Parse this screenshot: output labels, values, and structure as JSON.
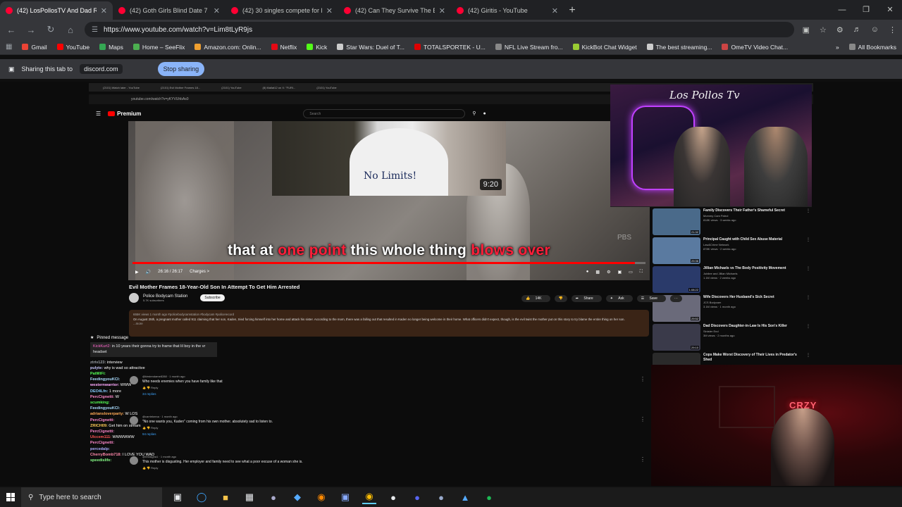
{
  "browser": {
    "tabs": [
      {
        "title": "(42) LosPollosTV And Dad R...",
        "active": true
      },
      {
        "title": "(42) Goth Girls Blind Date 7 Ni...",
        "active": false
      },
      {
        "title": "(42) 30 singles compete for lov...",
        "active": false
      },
      {
        "title": "(42) Can They Survive The Brea...",
        "active": false
      },
      {
        "title": "(42) Giritis - YouTube",
        "active": false
      }
    ],
    "url": "https://www.youtube.com/watch?v=Lim8tLyR9js",
    "bookmarks": [
      "Gmail",
      "YouTube",
      "Maps",
      "Home – SeeFlix",
      "Amazon.com: Onlin...",
      "Netflix",
      "Kick",
      "Star Wars: Duel of T...",
      "TOTALSPORTEK - U...",
      "NFL Live Stream fro...",
      "KickBot Chat Widget",
      "The best streaming...",
      "OmeTV Video Chat..."
    ],
    "all_bookmarks": "All Bookmarks",
    "sharing_text": "Sharing this tab to",
    "sharing_target": "discord.com",
    "stop_sharing": "Stop sharing"
  },
  "inner": {
    "tabs": [
      "(2101) Watch later - YouTube",
      "(2101) Evil Mother Frames 18...",
      "(2101) YouTube",
      "(8) Mallat12 on X: \"FURI...",
      "(2101) YouTube"
    ],
    "url": "youtube.com/watch?v=yKYVUhbAs0",
    "yt_logo": "Premium",
    "search_placeholder": "Search"
  },
  "video": {
    "pip_shirt_text": "No Limits!",
    "pip_time": "9:20",
    "caption_plain_1": "that at ",
    "caption_red_1": "one point",
    "caption_plain_2": " this whole thing ",
    "caption_red_2": "blows over",
    "watermark": "PBS",
    "progress": 0.98,
    "time": "26:16 / 26:17",
    "chapter": "Charges >",
    "title": "Evil Mother Frames 18-Year-Old Son In Attempt To Get Him Arrested",
    "channel": "Police Bodycam Station",
    "subs": "5.7K subscribers",
    "subscribe": "Subscribe",
    "likes": "14K",
    "share": "Share",
    "ask": "Ask",
    "save": "Save",
    "desc_meta": "655K views  1 month ago  #policebodycamstation #bodycam #policerecord",
    "desc_text": "On August 25th, a pregnant mother called 911 claiming that her son, Kaden, tried forcing himself into her home and attack his sister. According to the mom, there was a falling out that resulted in Kaden no longer being welcome in their home. What officers didn't expect, though, is the evil twist the mother put on this story to try blame the entire thing on her son.",
    "desc_more": "...more"
  },
  "cam": {
    "logo": "Los Pollos Tv",
    "neon_sign": "CRZY"
  },
  "recs": [
    {
      "title": "Family Discovers Their Father's Shameful Secret",
      "channel": "Mommy Cam Patrol",
      "meta": "818K views · 3 weeks ago",
      "dur": "21:32",
      "color": "#4a6a8a"
    },
    {
      "title": "Principal Caught with Child Sex Abuse Material",
      "channel": "Law&Crime Network",
      "meta": "878K views · 2 weeks ago",
      "dur": "29:36",
      "color": "#5a7aa0"
    },
    {
      "title": "Jillian Michaels vs The Body Positivity Movement",
      "channel": "Jubilee and Jillian Michaels",
      "meta": "1.1M views · 2 weeks ago",
      "dur": "1:08:22",
      "color": "#2a3a6a"
    },
    {
      "title": "Wife Discovers Her Husband's Sick Secret",
      "channel": "JCS Bodycam",
      "meta": "3.1M views · 1 month ago",
      "dur": "29:52",
      "color": "#6a6a7a"
    },
    {
      "title": "Dad Discovers Daughter-in-Law Is His Son's Killer",
      "channel": "Sinister End",
      "meta": "3M views · 2 months ago",
      "dur": "29:10",
      "color": "#3a3a4a"
    },
    {
      "title": "Cops Make Worst Discovery of Their Lives in Predator's Shed",
      "channel": "",
      "meta": "",
      "dur": "",
      "color": "#2a2a2a"
    }
  ],
  "chat": {
    "pinned_label": "Pinned message",
    "pinned_user": "KickKurt2:",
    "pinned_text": "in 10 years their gonna try to frame that lil boy in the vr headset",
    "messages": [
      {
        "user": "ztriv123:",
        "text": "interview",
        "color": "#9aa0a6"
      },
      {
        "user": "pulyte:",
        "text": "why is wad so attractive",
        "color": "#c8c8ff"
      },
      {
        "user": "PatWiFi:",
        "text": "",
        "color": "#55ff55"
      },
      {
        "user": "FeedingyouKCI:",
        "text": "",
        "color": "#aaddff"
      },
      {
        "user": "westernwarrior:",
        "text": "WWW",
        "color": "#ffaaff"
      },
      {
        "user": "DEO4Lfn:",
        "text": "1 more",
        "color": "#88ccff"
      },
      {
        "user": "PercCignetti:",
        "text": "W",
        "color": "#ff88cc"
      },
      {
        "user": "scumking:",
        "text": "",
        "color": "#55ff55"
      },
      {
        "user": "FeedingyouKCI:",
        "text": "",
        "color": "#aaddff"
      },
      {
        "user": "adriansloverparty:",
        "text": "W LOS",
        "color": "#ffaa55"
      },
      {
        "user": "PercCignetti:",
        "text": "",
        "color": "#ff88cc"
      },
      {
        "user": "ZRICH09:",
        "text": "Get him on stream",
        "color": "#ffcc55"
      },
      {
        "user": "PercCignetti:",
        "text": "",
        "color": "#ff88cc"
      },
      {
        "user": "Ulccem111:",
        "text": "WWWWWW",
        "color": "#ff5555"
      },
      {
        "user": "PercCignetti:",
        "text": "",
        "color": "#ff88cc"
      },
      {
        "user": "percedalp:",
        "text": "",
        "color": "#aaaaff"
      },
      {
        "user": "CherryBomb718:",
        "text": "I LOVE YOU WAD",
        "color": "#ff88aa"
      },
      {
        "user": "speedislife:",
        "text": "",
        "color": "#88ff88"
      }
    ]
  },
  "comments": [
    {
      "user": "@kirstendame8288 · 1 month ago",
      "text": "Who needs enemies when you have family like that",
      "replies": "34 replies"
    },
    {
      "user": "@carriekmna · 1 month ago",
      "text": "\"No one wants you, Kaden\" coming from his own mother. absolutely sad to listen to.",
      "replies": "94 replies"
    },
    {
      "user": "@reidAgha1 · 1 month ago",
      "text": "This mother is disgusting. Her employer and family need to see what a poor excuse of a woman she is.",
      "replies": ""
    }
  ],
  "taskbar": {
    "search_placeholder": "Type here to search"
  }
}
